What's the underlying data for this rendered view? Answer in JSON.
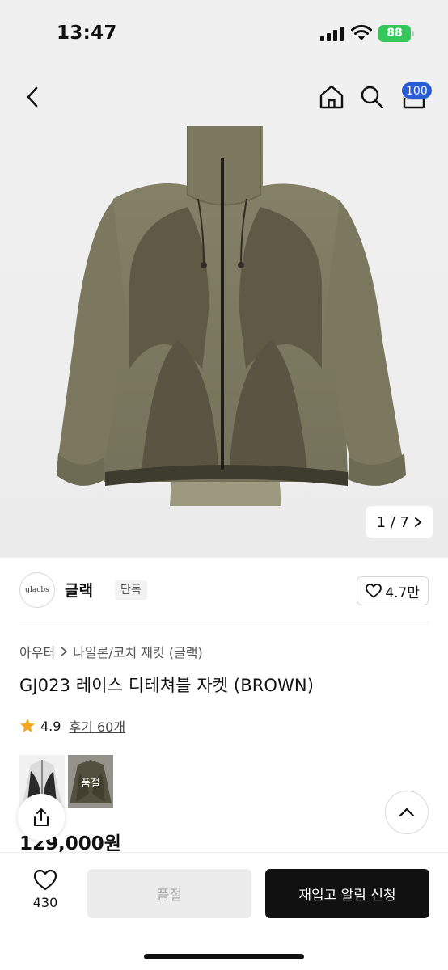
{
  "status_bar": {
    "time": "13:47",
    "battery": "88"
  },
  "header": {
    "cart_count": "100"
  },
  "gallery": {
    "counter": "1 / 7"
  },
  "brand": {
    "logo_text": "glacbs",
    "name": "글랙",
    "tag": "단독",
    "likes": "4.7만"
  },
  "breadcrumb": {
    "category": "아우터",
    "subcategory": "나일론/코치 재킷 (글랙)"
  },
  "product": {
    "title": "GJ023 레이스 디테쳐블 자켓 (BROWN)",
    "rating": "4.9",
    "reviews": "후기 60개",
    "price": "129,000원",
    "swatch_soldout_label": "품절"
  },
  "bottom_bar": {
    "wish_count": "430",
    "soldout_label": "품절",
    "restock_label": "재입고 알림 신청"
  },
  "colors": {
    "jacket_light": "#7d7a63",
    "jacket_dark": "#5d5843",
    "badge_blue": "#2b5bd7",
    "star": "#f5a623",
    "battery_green": "#34c759"
  }
}
